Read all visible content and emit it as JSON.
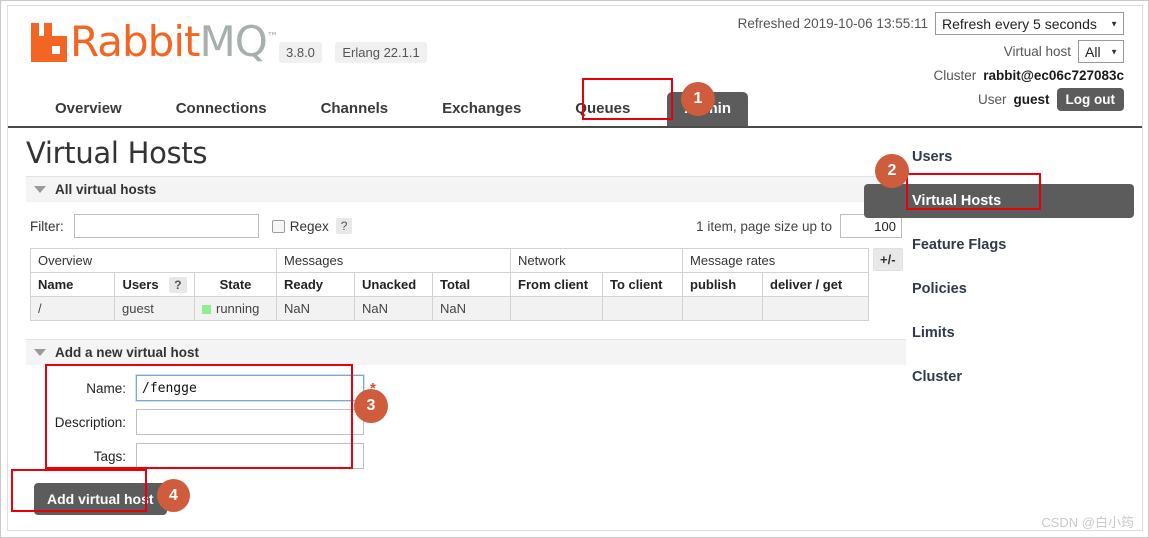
{
  "app": {
    "logo_text_primary": "Rabbit",
    "logo_text_secondary": "MQ",
    "logo_tm": "™",
    "version": "3.8.0",
    "erlang": "Erlang 22.1.1"
  },
  "header": {
    "refreshed_label": "Refreshed 2019-10-06 13:55:11",
    "refresh_select": "Refresh every 5 seconds",
    "vhost_label": "Virtual host",
    "vhost_select": "All",
    "cluster_label": "Cluster",
    "cluster_value": "rabbit@ec06c727083c",
    "user_label": "User",
    "user_value": "guest",
    "logout_label": "Log out"
  },
  "nav": {
    "tabs": [
      {
        "label": "Overview",
        "active": false
      },
      {
        "label": "Connections",
        "active": false
      },
      {
        "label": "Channels",
        "active": false
      },
      {
        "label": "Exchanges",
        "active": false
      },
      {
        "label": "Queues",
        "active": false
      },
      {
        "label": "Admin",
        "active": true
      }
    ]
  },
  "page": {
    "title": "Virtual Hosts",
    "all_section_label": "All virtual hosts",
    "add_section_label": "Add a new virtual host"
  },
  "filter": {
    "label": "Filter:",
    "value": "",
    "placeholder": "",
    "regex_label": "Regex",
    "help": "?",
    "pager_label": "1 item, page size up to",
    "page_size": "100"
  },
  "table": {
    "group_headers": [
      {
        "label": "Overview",
        "span": 3
      },
      {
        "label": "Messages",
        "span": 3
      },
      {
        "label": "Network",
        "span": 2
      },
      {
        "label": "Message rates",
        "span": 2
      }
    ],
    "columns": [
      "Name",
      "Users",
      "State",
      "Ready",
      "Unacked",
      "Total",
      "From client",
      "To client",
      "publish",
      "deliver / get"
    ],
    "users_help": "?",
    "toggle_columns": "+/-",
    "rows": [
      {
        "name": "/",
        "users": "guest",
        "state": "running",
        "ready": "NaN",
        "unacked": "NaN",
        "total": "NaN",
        "from_client": "",
        "to_client": "",
        "publish": "",
        "deliver_get": ""
      }
    ]
  },
  "add_form": {
    "name_label": "Name:",
    "name_value": "/fengge",
    "required_marker": "*",
    "description_label": "Description:",
    "description_value": "",
    "tags_label": "Tags:",
    "tags_value": "",
    "submit_label": "Add virtual host"
  },
  "sidebar": {
    "items": [
      {
        "label": "Users",
        "active": false
      },
      {
        "label": "Virtual Hosts",
        "active": true
      },
      {
        "label": "Feature Flags",
        "active": false
      },
      {
        "label": "Policies",
        "active": false
      },
      {
        "label": "Limits",
        "active": false
      },
      {
        "label": "Cluster",
        "active": false
      }
    ]
  },
  "annotations": {
    "markers": [
      "1",
      "2",
      "3",
      "4"
    ]
  },
  "watermark": {
    "text": "CSDN @白小筠"
  },
  "colors": {
    "brand_orange": "#f26522",
    "annotation_red": "#e8000d",
    "annotation_circle": "#cf5c3c",
    "active_gray": "#5c5c5c",
    "status_green": "#90ee90"
  }
}
